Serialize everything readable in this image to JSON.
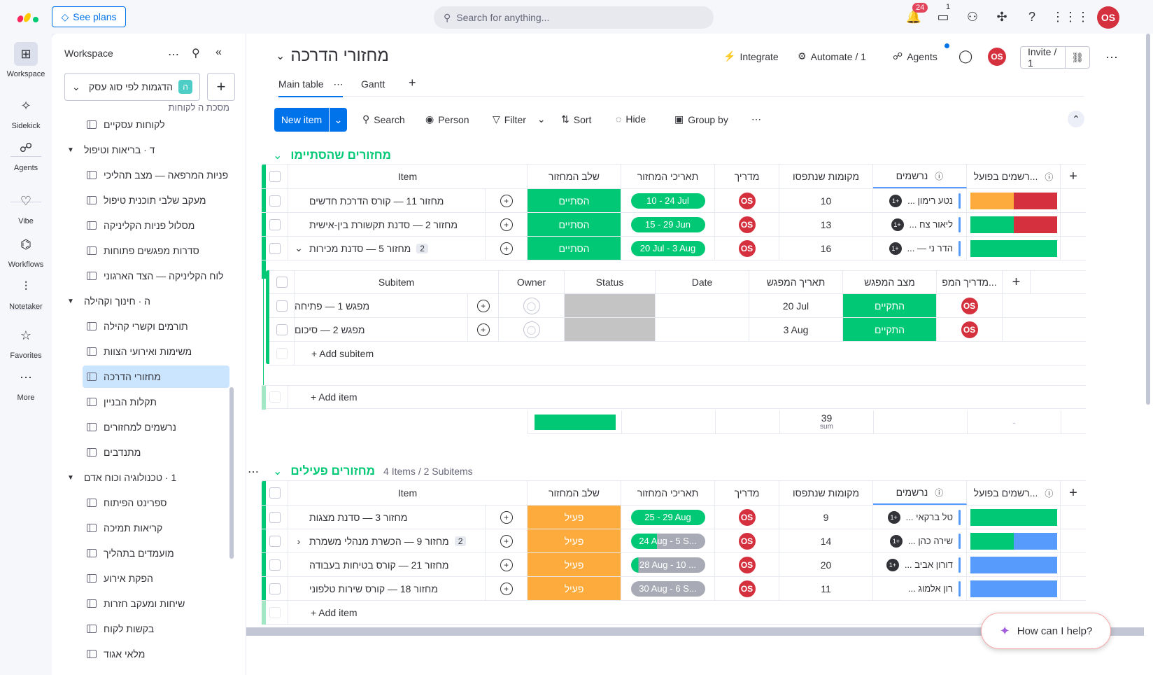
{
  "topbar": {
    "see_plans": "See plans",
    "search_placeholder": "Search for anything...",
    "notif_count": "24",
    "inbox_count": "1",
    "user_initials": "OS"
  },
  "rail": [
    {
      "label": "Workspace",
      "icon": "grid-icon"
    },
    {
      "label": "Sidekick",
      "icon": "sparkle-icon"
    },
    {
      "label": "Agents",
      "icon": "agents-icon"
    },
    {
      "label": "Vibe",
      "icon": "heart-icon"
    },
    {
      "label": "Workflows",
      "icon": "workflows-icon"
    },
    {
      "label": "Notetaker",
      "icon": "waveform-icon"
    },
    {
      "label": "Favorites",
      "icon": "star-icon"
    },
    {
      "label": "More",
      "icon": "dots-icon"
    }
  ],
  "sidebar": {
    "title": "Workspace",
    "workspace_name": "הדגמות לפי סוג עסק",
    "workspace_letter": "ה",
    "partial_top": "מסכת ה לקוחות",
    "items": [
      {
        "type": "board",
        "label": "לקוחות עסקיים"
      },
      {
        "type": "folder",
        "label": "ד · בריאות וטיפול"
      },
      {
        "type": "board",
        "label": "פניות המרפאה — מצב תהליכי"
      },
      {
        "type": "board",
        "label": "מעקב שלבי תוכנית טיפול"
      },
      {
        "type": "board",
        "label": "מסלול פניות הקליניקה"
      },
      {
        "type": "board",
        "label": "סדרות מפגשים פתוחות"
      },
      {
        "type": "board",
        "label": "לוח הקליניקה — הצד הארגוני"
      },
      {
        "type": "folder",
        "label": "ה · חינוך וקהילה"
      },
      {
        "type": "board",
        "label": "תורמים וקשרי קהילה"
      },
      {
        "type": "board",
        "label": "משימות ואירועי הצוות"
      },
      {
        "type": "board",
        "label": "מחזורי הדרכה",
        "active": true
      },
      {
        "type": "board",
        "label": "תקלות הבניין"
      },
      {
        "type": "board",
        "label": "נרשמים למחזורים"
      },
      {
        "type": "board",
        "label": "מתנדבים"
      },
      {
        "type": "folder",
        "label": "1 · טכנולוגיה וכוח אדם"
      },
      {
        "type": "board",
        "label": "ספרינט הפיתוח"
      },
      {
        "type": "board",
        "label": "קריאות תמיכה"
      },
      {
        "type": "board",
        "label": "מועמדים בתהליך"
      },
      {
        "type": "board",
        "label": "הפקת אירוע"
      },
      {
        "type": "board",
        "label": "שיחות ומעקב חזרות"
      },
      {
        "type": "board",
        "label": "בקשות לקוח"
      },
      {
        "type": "board",
        "label": "מלאי אגוד"
      }
    ]
  },
  "board": {
    "title": "מחזורי הדרכה",
    "integrate": "Integrate",
    "automate": "Automate / 1",
    "agents": "Agents",
    "invite": "Invite / 1",
    "tabs": [
      "Main table",
      "Gantt"
    ],
    "toolbar": {
      "new_item": "New item",
      "search": "Search",
      "person": "Person",
      "filter": "Filter",
      "sort": "Sort",
      "hide": "Hide",
      "group_by": "Group by"
    },
    "columns": {
      "item": "Item",
      "stage": "שלב המחזור",
      "dates": "תאריכי המחזור",
      "instructor": "מדריך",
      "seats": "מקומות שנתפסו",
      "registered": "נרשמים",
      "actual": "רשמים בפועל..."
    },
    "colors": {
      "done": "#00c875",
      "active": "#fdab3d",
      "blue": "#579bfc",
      "red": "#d5303e",
      "orange": "#fdab3d"
    },
    "group1": {
      "title": "מחזורים שהסתיימו",
      "color": "#00c875",
      "rows": [
        {
          "name": "מחזור 11 — קורס הדרכת חדשים",
          "stage": "הסתיים",
          "dates": "10 - 24 Jul",
          "seats": "10",
          "person": "נטע רימון ...",
          "plus": "+1",
          "bar": [
            {
              "c": "#fdab3d",
              "w": 0.5
            },
            {
              "c": "#d5303e",
              "w": 0.5
            }
          ]
        },
        {
          "name": "מחזור 2 — סדנת תקשורת בין-אישית",
          "stage": "הסתיים",
          "dates": "15 - 29 Jun",
          "seats": "13",
          "person": "ליאור צח ...",
          "plus": "+1",
          "bar": [
            {
              "c": "#00c875",
              "w": 0.5
            },
            {
              "c": "#d5303e",
              "w": 0.5
            }
          ]
        },
        {
          "name": "מחזור 5 — סדנת מכירות",
          "sub_count": "2",
          "stage": "הסתיים",
          "dates": "20 Jul - 3 Aug",
          "seats": "16",
          "person": "הדר ני — ...",
          "plus": "+1",
          "bar": [
            {
              "c": "#00c875",
              "w": 1
            }
          ]
        }
      ],
      "subitems": {
        "columns": {
          "subitem": "Subitem",
          "owner": "Owner",
          "status": "Status",
          "date": "Date",
          "meet_date": "תאריך המפגש",
          "meet_state": "מצב המפגש",
          "meet_instr": "מדריך המפ..."
        },
        "rows": [
          {
            "name": "מפגש 1 — פתיחה",
            "meet_date": "20 Jul",
            "meet_state": "התקיים"
          },
          {
            "name": "מפגש 2 — סיכום",
            "meet_date": "3 Aug",
            "meet_state": "התקיים"
          }
        ],
        "add": "+ Add subitem"
      },
      "add_item": "+ Add item",
      "sum_value": "39",
      "sum_label": "sum",
      "dash": "-"
    },
    "group2": {
      "title": "מחזורים פעילים",
      "color": "#00c875",
      "meta": "4 Items / 2 Subitems",
      "rows": [
        {
          "name": "מחזור 3 — סדנת מצגות",
          "stage": "פעיל",
          "dates": "25 - 29 Aug",
          "date_fill": 1,
          "seats": "9",
          "person": "טל ברקאי ...",
          "plus": "+1",
          "bar": [
            {
              "c": "#00c875",
              "w": 1
            }
          ]
        },
        {
          "name": "מחזור 9 — הכשרת מנהלי משמרת",
          "sub_count": "2",
          "stage": "פעיל",
          "dates": "24 Aug - 5 S...",
          "date_fill": 0.35,
          "seats": "14",
          "person": "שירה כהן ...",
          "plus": "+1",
          "bar": [
            {
              "c": "#00c875",
              "w": 0.5
            },
            {
              "c": "#579bfc",
              "w": 0.5
            }
          ]
        },
        {
          "name": "מחזור 21 — קורס בטיחות בעבודה",
          "stage": "פעיל",
          "dates": "28 Aug - 10 ...",
          "date_fill": 0.1,
          "seats": "20",
          "person": "דורון אביב ...",
          "plus": "+1",
          "bar": [
            {
              "c": "#579bfc",
              "w": 1
            }
          ]
        },
        {
          "name": "מחזור 18 — קורס שירות טלפוני",
          "stage": "פעיל",
          "dates": "30 Aug - 6 S...",
          "date_fill": 0,
          "seats": "11",
          "person": "רון אלמוג ...",
          "plus": "",
          "bar": [
            {
              "c": "#579bfc",
              "w": 1
            }
          ]
        }
      ],
      "add_item": "+ Add item"
    }
  },
  "help": "How can I help?"
}
